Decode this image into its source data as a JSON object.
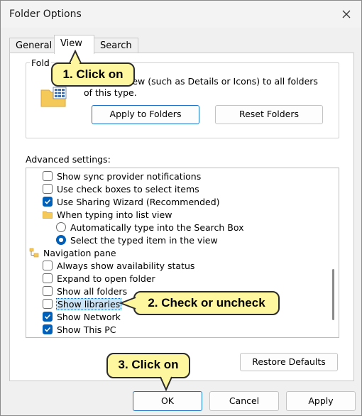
{
  "window": {
    "title": "Folder Options"
  },
  "tabs": [
    {
      "label": "General"
    },
    {
      "label": "View"
    },
    {
      "label": "Search"
    }
  ],
  "folder_views": {
    "label_partial": "Fold",
    "description": "pply this view (such as Details or Icons) to all folders of this type.",
    "apply_button": "Apply to Folders",
    "reset_button": "Reset Folders"
  },
  "advanced": {
    "label": "Advanced settings:",
    "items": [
      {
        "label": "Show sync provider notifications",
        "type": "checkbox",
        "checked": false
      },
      {
        "label": "Use check boxes to select items",
        "type": "checkbox",
        "checked": false
      },
      {
        "label": "Use Sharing Wizard (Recommended)",
        "type": "checkbox",
        "checked": true
      },
      {
        "label": "When typing into list view",
        "type": "folder"
      },
      {
        "label": "Automatically type into the Search Box",
        "type": "radio",
        "checked": false
      },
      {
        "label": "Select the typed item in the view",
        "type": "radio",
        "checked": true
      },
      {
        "label": "Navigation pane",
        "type": "nav-folder"
      },
      {
        "label": "Always show availability status",
        "type": "checkbox",
        "checked": false
      },
      {
        "label": "Expand to open folder",
        "type": "checkbox",
        "checked": false
      },
      {
        "label": "Show all folders",
        "type": "checkbox",
        "checked": false
      },
      {
        "label": "Show libraries",
        "type": "checkbox",
        "checked": false,
        "selected": true
      },
      {
        "label": "Show Network",
        "type": "checkbox",
        "checked": true
      },
      {
        "label": "Show This PC",
        "type": "checkbox",
        "checked": true
      }
    ]
  },
  "restore_defaults": "Restore Defaults",
  "footer": {
    "ok": "OK",
    "cancel": "Cancel",
    "apply": "Apply"
  },
  "callouts": {
    "step1": "1. Click on",
    "step2": "2. Check or uncheck",
    "step3": "3. Click on"
  },
  "colors": {
    "accent": "#005fb8",
    "callout_fill": "#fff6a0",
    "selection": "#cce4f7"
  }
}
